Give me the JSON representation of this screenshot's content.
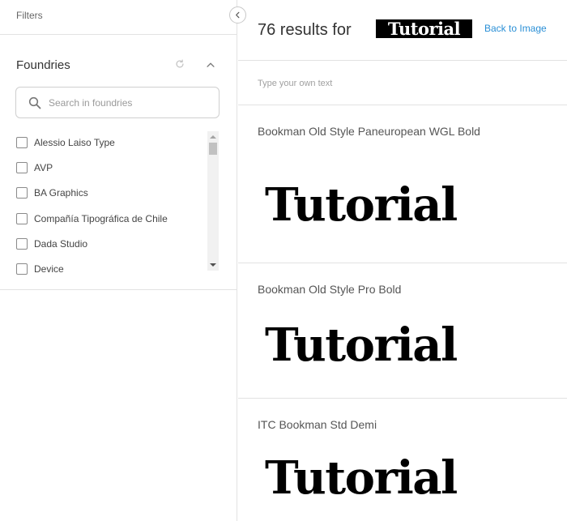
{
  "filters": {
    "title": "Filters"
  },
  "foundries": {
    "title": "Foundries",
    "search_placeholder": "Search in foundries",
    "items": [
      {
        "label": "Alessio Laiso Type",
        "checked": false
      },
      {
        "label": "AVP",
        "checked": false
      },
      {
        "label": "BA Graphics",
        "checked": false
      },
      {
        "label": "Compañía Tipográfica de Chile",
        "checked": false
      },
      {
        "label": "Dada Studio",
        "checked": false
      },
      {
        "label": "Device",
        "checked": false
      }
    ]
  },
  "results": {
    "count_text": "76 results for",
    "query_text": "Tutorial",
    "back_link": "Back to Image",
    "input_placeholder": "Type your own text",
    "fonts": [
      {
        "name": "Bookman Old Style Paneuropean WGL Bold",
        "sample": "Tutorial"
      },
      {
        "name": "Bookman Old Style Pro Bold",
        "sample": "Tutorial"
      },
      {
        "name": "ITC Bookman Std Demi",
        "sample": "Tutorial"
      }
    ]
  },
  "colors": {
    "link": "#2a8fd6",
    "border": "#e2e2e2",
    "text": "#333333",
    "sample": "#000000"
  },
  "icons": [
    "chevron-left-icon",
    "reset-icon",
    "chevron-up-icon",
    "search-icon",
    "scroll-up-arrow-icon",
    "scroll-down-arrow-icon"
  ]
}
